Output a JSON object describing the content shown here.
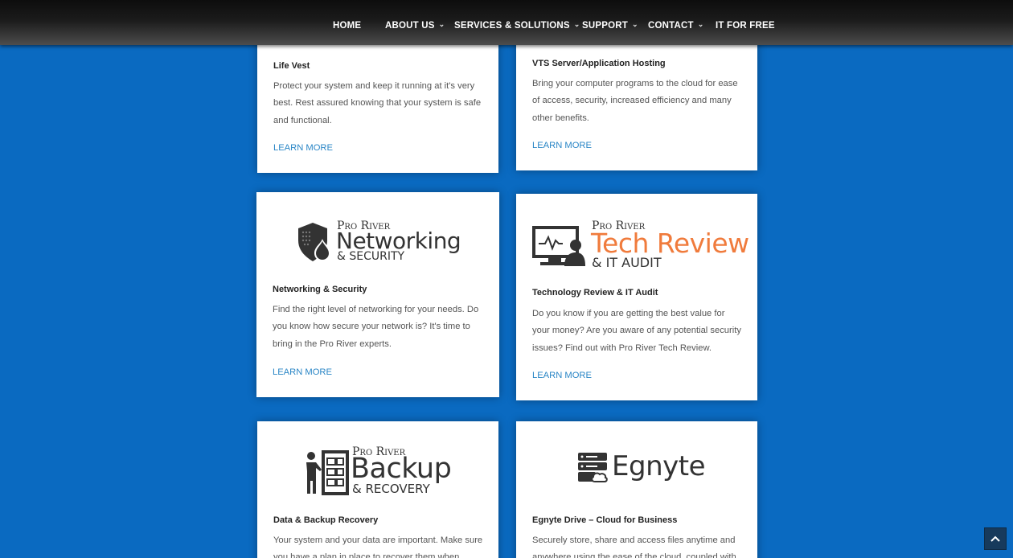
{
  "nav": {
    "items": [
      {
        "label": "HOME",
        "has_dropdown": false
      },
      {
        "label": "ABOUT US",
        "has_dropdown": true
      },
      {
        "label": "SERVICES & SOLUTIONS",
        "has_dropdown": true
      },
      {
        "label": "SUPPORT",
        "has_dropdown": true
      },
      {
        "label": "CONTACT",
        "has_dropdown": true
      },
      {
        "label": "IT FOR FREE",
        "has_dropdown": false
      }
    ]
  },
  "cards": [
    {
      "title": "Life Vest",
      "text": "Protect your system and keep it running at it's very best. Rest assured knowing that your system is safe and functional.",
      "link": "LEARN MORE"
    },
    {
      "title": "VTS Server/Application Hosting",
      "text": "Bring your computer programs to the cloud for ease of access, security, increased efficiency and many other benefits.",
      "link": "LEARN MORE"
    },
    {
      "logo": {
        "pro": "Pro River",
        "main": "Networking",
        "sub": "& SECURITY",
        "icon": "shield-lock-icon"
      },
      "title": "Networking & Security",
      "text": "Find the right level of networking for your needs. Do you know how secure your network is? It's time to bring in the Pro River experts.",
      "link": "LEARN MORE"
    },
    {
      "logo": {
        "pro": "Pro River",
        "main": "Tech Review",
        "sub": "& IT AUDIT",
        "icon": "monitor-person-icon"
      },
      "title": "Technology Review & IT Audit",
      "text": "Do you know if you are getting the best value for your money? Are you aware of any potential security issues? Find out with Pro River Tech Review.",
      "link": "LEARN MORE"
    },
    {
      "logo": {
        "pro": "Pro River",
        "main": "Backup",
        "sub": "& RECOVERY",
        "icon": "presenter-server-icon"
      },
      "title": "Data & Backup Recovery",
      "text": "Your system and your data are important. Make sure you have a plan in place to recover them when",
      "link": ""
    },
    {
      "logo": {
        "main": "Egnyte",
        "icon": "server-cloud-icon"
      },
      "title": "Egnyte Drive – Cloud for Business",
      "text": "Securely store, share and access files anytime and anywhere using the ease of the cloud, coupled with",
      "link": ""
    }
  ],
  "colors": {
    "page_background": "#0a6ac1",
    "link": "#2a86c6",
    "logo_accent": "#f07b3c",
    "scroll_top_button": "#173a5c"
  },
  "scroll_top": {
    "icon": "chevron-up-icon"
  }
}
